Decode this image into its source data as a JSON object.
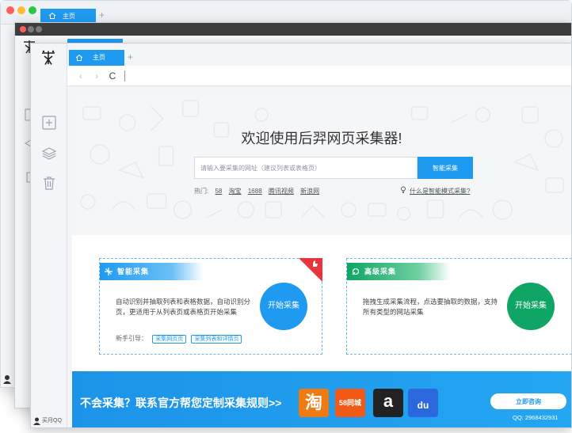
{
  "app": {
    "tab_label": "主页",
    "new_tab": "+",
    "user_label": "买月QQ"
  },
  "toolbar": {
    "back": "‹",
    "forward": "›",
    "reload": "C"
  },
  "hero": {
    "title": "欢迎使用后羿网页采集器!",
    "search_placeholder": "请输入要采集的网址（建议列表或表格页）",
    "search_button": "智能采集",
    "hot_label": "热门:",
    "hot_links": [
      "58",
      "淘宝",
      "1688",
      "腾讯视频",
      "新浪网"
    ],
    "smart_mode_link": "什么是智能模式采集?"
  },
  "cards": {
    "smart": {
      "title": "智能采集",
      "desc": "自动识别并抽取列表和表格数据，自动识别分页，更适用于从列表页或表格页开始采集",
      "guide_label": "新手引导：",
      "guide_links": [
        "采集网页页",
        "采集列表和详情页"
      ],
      "button": "开始采集",
      "accent": "#1e9af0"
    },
    "advanced": {
      "title": "高级采集",
      "desc": "拖拽生成采集流程，点选要抽取的数据，支持所有类型的网站采集",
      "button": "开始采集",
      "accent": "#0fa564"
    }
  },
  "banner": {
    "text": "不会采集？联系官方帮您定制采集规则>>",
    "brands": [
      "淘",
      "58同城",
      "a",
      "du"
    ],
    "consult_button": "立即咨询",
    "qq": "QQ: 2968432931"
  }
}
